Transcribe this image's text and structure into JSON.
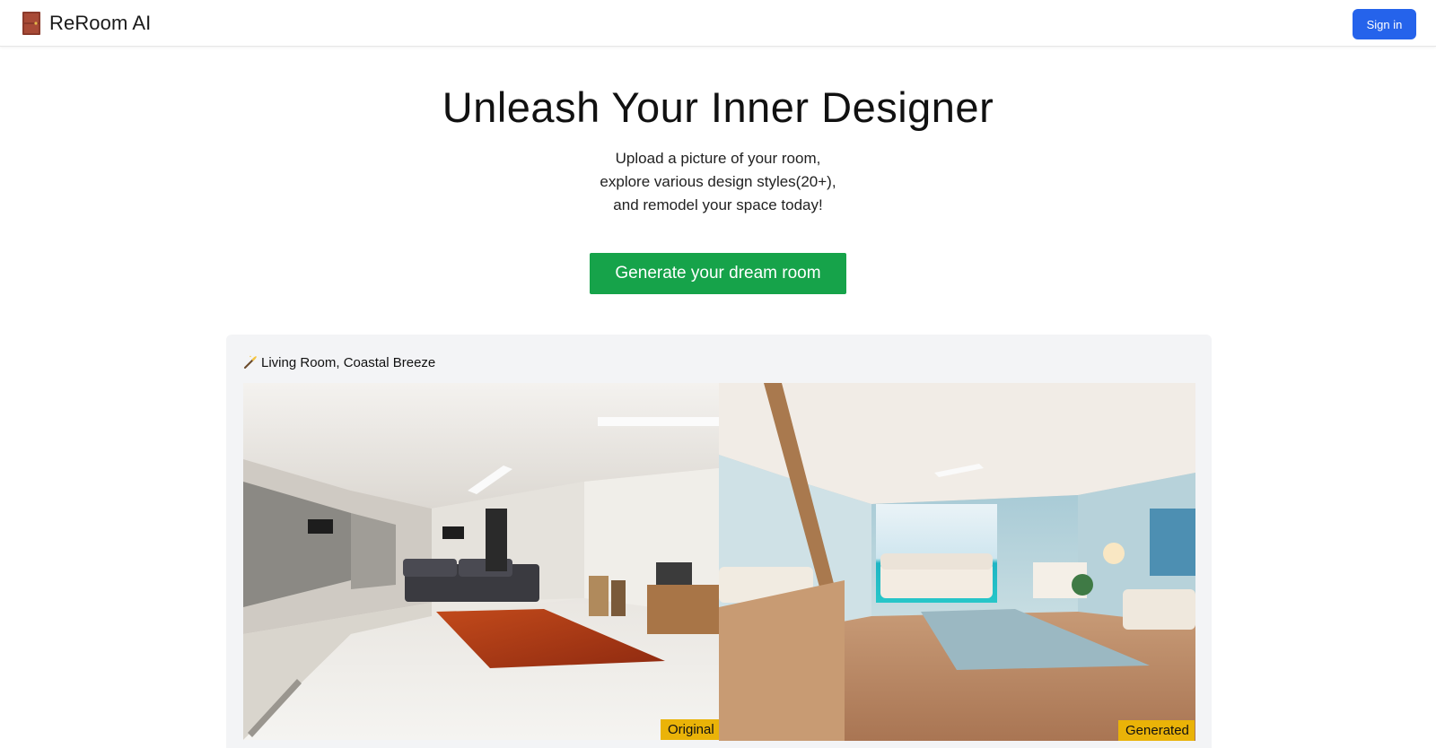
{
  "header": {
    "brand_icon": "door-icon",
    "brand_name": "ReRoom AI",
    "signin_label": "Sign in"
  },
  "hero": {
    "title": "Unleash Your Inner Designer",
    "subtitle_lines": [
      "Upload a picture of your room,",
      "explore various design styles(20+),",
      "and remodel your space today!"
    ],
    "cta_label": "Generate your dream room"
  },
  "showcase": {
    "caption_icon": "magic-wand-icon",
    "caption": "Living Room, Coastal Breeze",
    "original_badge": "Original",
    "generated_badge": "Generated"
  },
  "colors": {
    "primary_blue": "#2563eb",
    "cta_green": "#16a34a",
    "badge_yellow": "#eab308",
    "card_gray": "#f3f4f6"
  }
}
